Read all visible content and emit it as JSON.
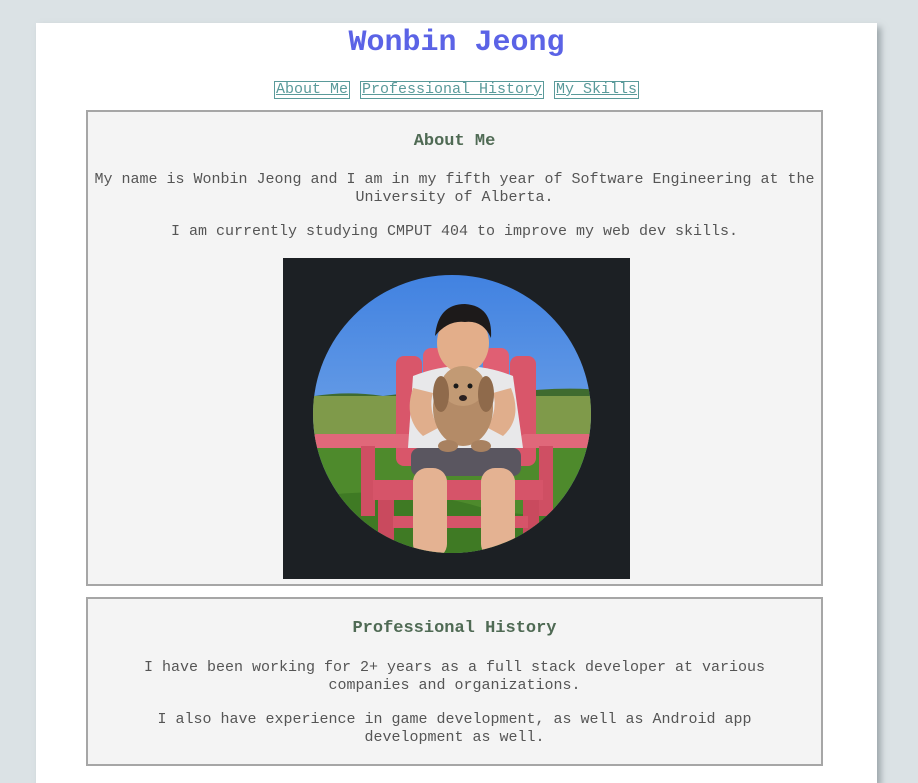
{
  "header": {
    "title": "Wonbin Jeong"
  },
  "nav": {
    "items": [
      {
        "label": "About Me"
      },
      {
        "label": "Professional History"
      },
      {
        "label": "My Skills"
      }
    ]
  },
  "about": {
    "heading": "About Me",
    "paragraph1": "My name is Wonbin Jeong and I am in my fifth year of Software Engineering at the University of Alberta.",
    "paragraph2": "I am currently studying CMPUT 404 to improve my web dev skills.",
    "photo_alt": "Wonbin Jeong holding a dog in a red chair"
  },
  "history": {
    "heading": "Professional History",
    "paragraph1": "I have been working for 2+ years as a full stack developer at various companies and organizations.",
    "paragraph2": "I also have experience in game development, as well as Android app development as well."
  },
  "colors": {
    "title": "#5b63e6",
    "nav_link": "#5a9a9a",
    "heading": "#4f6a54",
    "section_bg": "#f4f4f4",
    "page_bg": "#dbe2e5"
  }
}
